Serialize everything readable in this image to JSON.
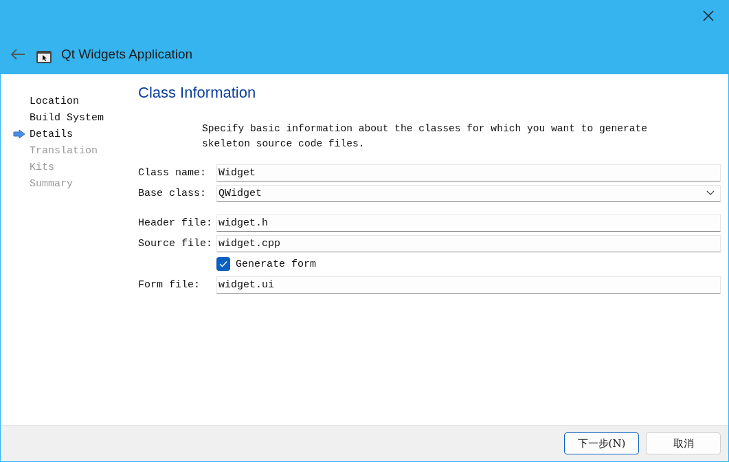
{
  "window": {
    "title": "Qt Widgets Application"
  },
  "steps": [
    {
      "label": "Location",
      "selected": false,
      "disabled": false
    },
    {
      "label": "Build System",
      "selected": false,
      "disabled": false
    },
    {
      "label": "Details",
      "selected": true,
      "disabled": false
    },
    {
      "label": "Translation",
      "selected": false,
      "disabled": true
    },
    {
      "label": "Kits",
      "selected": false,
      "disabled": true
    },
    {
      "label": "Summary",
      "selected": false,
      "disabled": true
    }
  ],
  "page": {
    "title": "Class Information",
    "description": "Specify basic information about the classes for which you want to generate skeleton source code files."
  },
  "fields": [
    {
      "kind": "text",
      "label": "Class name:",
      "value": "Widget"
    },
    {
      "kind": "dropdown",
      "label": "Base class:",
      "value": "QWidget"
    },
    {
      "kind": "spacer"
    },
    {
      "kind": "text",
      "label": "Header file:",
      "value": "widget.h"
    },
    {
      "kind": "text",
      "label": "Source file:",
      "value": "widget.cpp"
    },
    {
      "kind": "checkbox",
      "label": "Generate form",
      "checked": true
    },
    {
      "kind": "text",
      "label": "Form file:",
      "value": "widget.ui"
    }
  ],
  "buttons": [
    {
      "label": "下一步(N)",
      "default": true
    },
    {
      "label": "取消",
      "default": false
    }
  ]
}
